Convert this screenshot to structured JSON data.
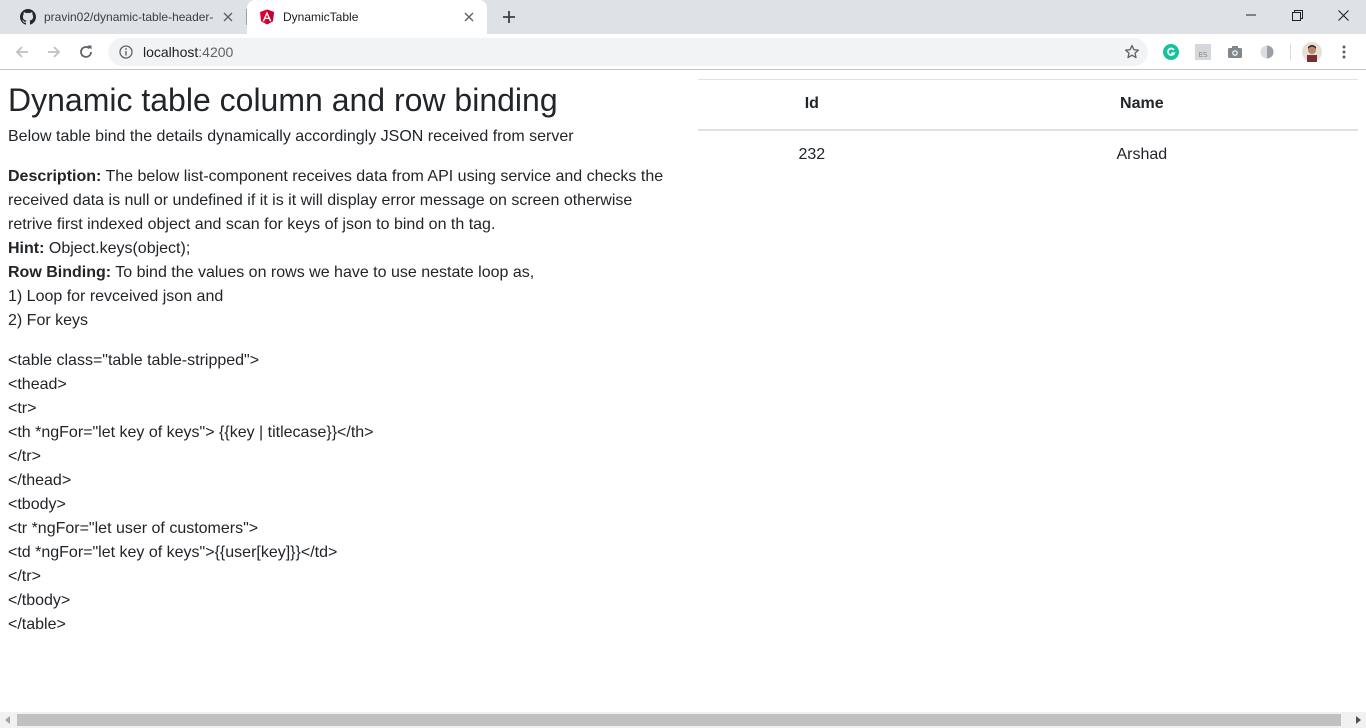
{
  "browser": {
    "tabs": [
      {
        "title": "pravin02/dynamic-table-header-",
        "icon": "github-icon",
        "active": false
      },
      {
        "title": "DynamicTable",
        "icon": "angular-icon",
        "active": true
      }
    ],
    "address": {
      "host": "localhost",
      "port": ":4200"
    }
  },
  "page": {
    "title": "Dynamic table column and row binding",
    "subtitle": "Below table bind the details dynamically accordingly JSON received from server",
    "description": {
      "label": "Description:",
      "text": " The below list-component receives data from API using service and checks the received data is null or undefined if it is it will display error message on screen otherwise retrive first indexed object and scan for keys of json to bind on th tag."
    },
    "hint": {
      "label": "Hint:",
      "text": " Object.keys(object);"
    },
    "row_binding": {
      "label": "Row Binding:",
      "text": " To bind the values on rows we have to use nestate loop as,"
    },
    "steps": [
      "1) Loop for revceived json and",
      "2) For keys"
    ],
    "code_lines": [
      "<table class=\"table table-stripped\">",
      "<thead>",
      "<tr>",
      "<th *ngFor=\"let key of keys\"> {{key | titlecase}}</th>",
      "</tr>",
      "</thead>",
      "<tbody>",
      "<tr *ngFor=\"let user of customers\">",
      "<td *ngFor=\"let key of keys\">{{user[key]}}</td>",
      "</tr>",
      "</tbody>",
      "</table>"
    ]
  },
  "table": {
    "headers": [
      "Id",
      "Name"
    ],
    "rows": [
      [
        "232",
        "Arshad"
      ]
    ]
  }
}
